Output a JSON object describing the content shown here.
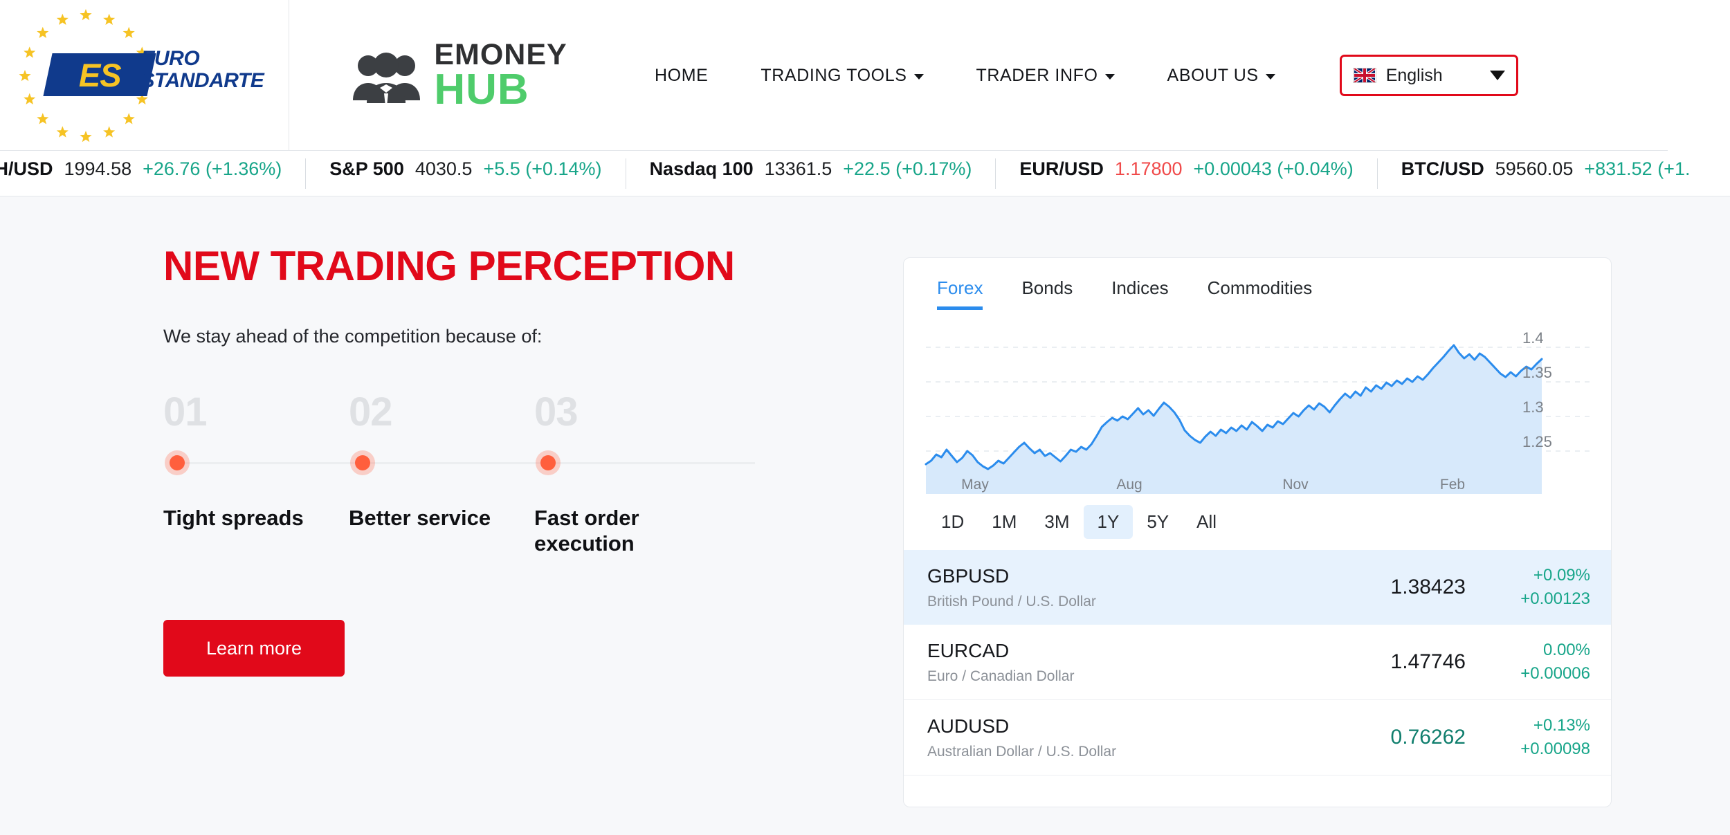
{
  "header": {
    "logo": {
      "badge_text": "ES",
      "word_line1": "EURO",
      "word_line2": "STANDARTE"
    },
    "brand": {
      "top": "EMONEY",
      "bottom": "HUB"
    },
    "nav": [
      {
        "label": "HOME",
        "has_caret": false
      },
      {
        "label": "TRADING TOOLS",
        "has_caret": true
      },
      {
        "label": "TRADER INFO",
        "has_caret": true
      },
      {
        "label": "ABOUT US",
        "has_caret": true
      }
    ],
    "language": {
      "value": "English",
      "flag": "uk-flag-icon",
      "caret": "chevron-down-icon"
    }
  },
  "ticker": [
    {
      "name": "TH/USD",
      "price": "1994.58",
      "change": "+26.76 (+1.36%)",
      "price_negative": false
    },
    {
      "name": "S&P 500",
      "price": "4030.5",
      "change": "+5.5 (+0.14%)",
      "price_negative": false
    },
    {
      "name": "Nasdaq 100",
      "price": "13361.5",
      "change": "+22.5 (+0.17%)",
      "price_negative": false
    },
    {
      "name": "EUR/USD",
      "price": "1.17800",
      "change": "+0.00043 (+0.04%)",
      "price_negative": true
    },
    {
      "name": "BTC/USD",
      "price": "59560.05",
      "change": "+831.52 (+1.",
      "price_negative": false
    }
  ],
  "hero": {
    "headline": "NEW TRADING PERCEPTION",
    "subline": "We stay ahead of the competition because of:",
    "steps": [
      {
        "number": "01",
        "label": "Tight spreads"
      },
      {
        "number": "02",
        "label": "Better service"
      },
      {
        "number": "03",
        "label": "Fast order execution"
      }
    ],
    "cta": "Learn more"
  },
  "widget": {
    "tabs": [
      {
        "label": "Forex",
        "active": true
      },
      {
        "label": "Bonds",
        "active": false
      },
      {
        "label": "Indices",
        "active": false
      },
      {
        "label": "Commodities",
        "active": false
      }
    ],
    "ranges": [
      {
        "label": "1D",
        "active": false
      },
      {
        "label": "1M",
        "active": false
      },
      {
        "label": "3M",
        "active": false
      },
      {
        "label": "1Y",
        "active": true
      },
      {
        "label": "5Y",
        "active": false
      },
      {
        "label": "All",
        "active": false
      }
    ],
    "quotes": [
      {
        "symbol": "GBPUSD",
        "desc": "British Pound / U.S. Dollar",
        "price": "1.38423",
        "pct": "+0.09%",
        "abs": "+0.00123",
        "active": true,
        "price_teal": false
      },
      {
        "symbol": "EURCAD",
        "desc": "Euro / Canadian Dollar",
        "price": "1.47746",
        "pct": "0.00%",
        "abs": "+0.00006",
        "active": false,
        "price_teal": false
      },
      {
        "symbol": "AUDUSD",
        "desc": "Australian Dollar / U.S. Dollar",
        "price": "0.76262",
        "pct": "+0.13%",
        "abs": "+0.00098",
        "active": false,
        "price_teal": true
      }
    ]
  },
  "chart_data": {
    "type": "area",
    "title": "",
    "xlabel": "",
    "ylabel": "",
    "ylim": [
      1.21,
      1.42
    ],
    "grid": true,
    "legend": "none",
    "line_color": "#2b8ced",
    "fill_color": "#d7e9fb",
    "xtick_labels": [
      "May",
      "Aug",
      "Nov",
      "Feb"
    ],
    "xtick_positions": [
      0.08,
      0.33,
      0.6,
      0.855
    ],
    "ytick_labels": [
      "1.25",
      "1.3",
      "1.35",
      "1.4"
    ],
    "ytick_values": [
      1.25,
      1.3,
      1.35,
      1.4
    ],
    "series": [
      {
        "name": "GBPUSD",
        "values": [
          1.231,
          1.236,
          1.245,
          1.241,
          1.252,
          1.243,
          1.234,
          1.24,
          1.25,
          1.244,
          1.234,
          1.228,
          1.224,
          1.229,
          1.236,
          1.232,
          1.24,
          1.248,
          1.256,
          1.262,
          1.254,
          1.247,
          1.252,
          1.243,
          1.247,
          1.241,
          1.235,
          1.243,
          1.252,
          1.249,
          1.256,
          1.252,
          1.26,
          1.272,
          1.285,
          1.292,
          1.298,
          1.294,
          1.3,
          1.296,
          1.304,
          1.312,
          1.303,
          1.309,
          1.301,
          1.311,
          1.32,
          1.314,
          1.306,
          1.295,
          1.28,
          1.272,
          1.266,
          1.262,
          1.271,
          1.278,
          1.272,
          1.281,
          1.276,
          1.284,
          1.279,
          1.287,
          1.281,
          1.292,
          1.286,
          1.279,
          1.288,
          1.284,
          1.293,
          1.289,
          1.297,
          1.305,
          1.3,
          1.309,
          1.316,
          1.31,
          1.319,
          1.314,
          1.306,
          1.316,
          1.325,
          1.333,
          1.327,
          1.336,
          1.33,
          1.342,
          1.336,
          1.345,
          1.34,
          1.349,
          1.344,
          1.352,
          1.347,
          1.355,
          1.35,
          1.358,
          1.353,
          1.361,
          1.37,
          1.378,
          1.386,
          1.395,
          1.403,
          1.392,
          1.384,
          1.39,
          1.382,
          1.391,
          1.386,
          1.378,
          1.37,
          1.362,
          1.357,
          1.364,
          1.358,
          1.366,
          1.372,
          1.368,
          1.376,
          1.383
        ]
      }
    ]
  }
}
